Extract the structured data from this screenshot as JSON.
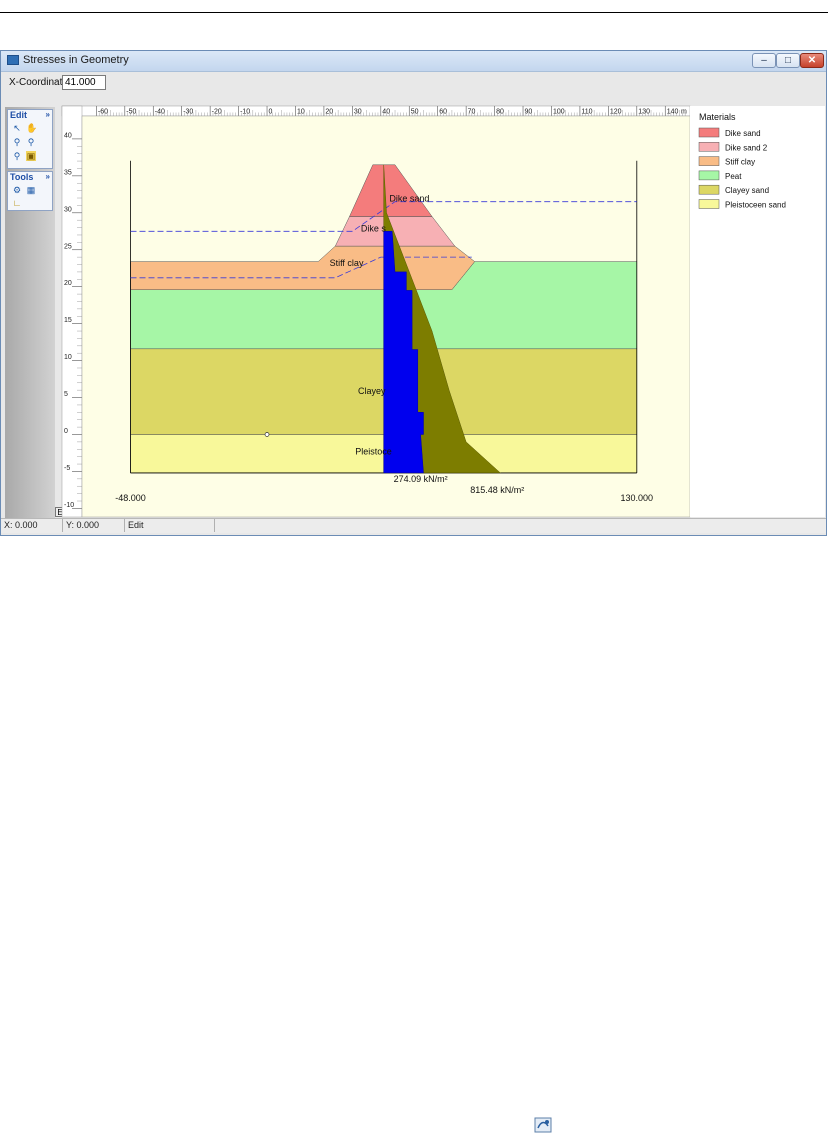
{
  "window": {
    "title": "Stresses in Geometry",
    "min": "–",
    "max": "□",
    "close": "✕"
  },
  "xcoord": {
    "label": "X-Coordinate",
    "value": "41.000"
  },
  "panel": {
    "edit": {
      "title": "Edit",
      "chev": "»"
    },
    "tools": {
      "title": "Tools",
      "chev": "»"
    },
    "e_button": "E"
  },
  "ruler": {
    "x_labels": [
      "-60",
      "-50",
      "-40",
      "-30",
      "-20",
      "-10",
      "0",
      "10",
      "20",
      "30",
      "40",
      "50",
      "60",
      "70",
      "80",
      "90",
      "100",
      "110",
      "120",
      "130",
      "140"
    ],
    "x_unit": "m",
    "y_labels": [
      "40",
      "35",
      "30",
      "25",
      "20",
      "15",
      "10",
      "5",
      "0",
      "-5",
      "-10"
    ]
  },
  "plot": {
    "x_left": "-48.000",
    "x_right": "130.000",
    "stress_left": "274.09 kN/m²",
    "stress_right": "815.48 kN/m²",
    "layer_labels": [
      {
        "text": "Dike sand",
        "x": 43,
        "y": 31.5
      },
      {
        "text": "Dike s",
        "x": 33,
        "y": 27.5
      },
      {
        "text": "Stiff clay",
        "x": 22,
        "y": 22.8
      },
      {
        "text": "Clayey",
        "x": 32,
        "y": 5.5
      },
      {
        "text": "Pleistoce",
        "x": 31,
        "y": -2.7
      }
    ]
  },
  "materials": {
    "title": "Materials",
    "items": [
      {
        "name": "Dike sand",
        "color": "#f47c7c"
      },
      {
        "name": "Dike sand 2",
        "color": "#f7b0b4"
      },
      {
        "name": "Stiff clay",
        "color": "#f9bc86"
      },
      {
        "name": "Peat",
        "color": "#a6f6a6"
      },
      {
        "name": "Clayey sand",
        "color": "#dcd764"
      },
      {
        "name": "Pleistoceen sand",
        "color": "#f8f89a"
      }
    ]
  },
  "status": {
    "x": "X: 0.000",
    "y": "Y: 0.000",
    "mode": "Edit"
  }
}
